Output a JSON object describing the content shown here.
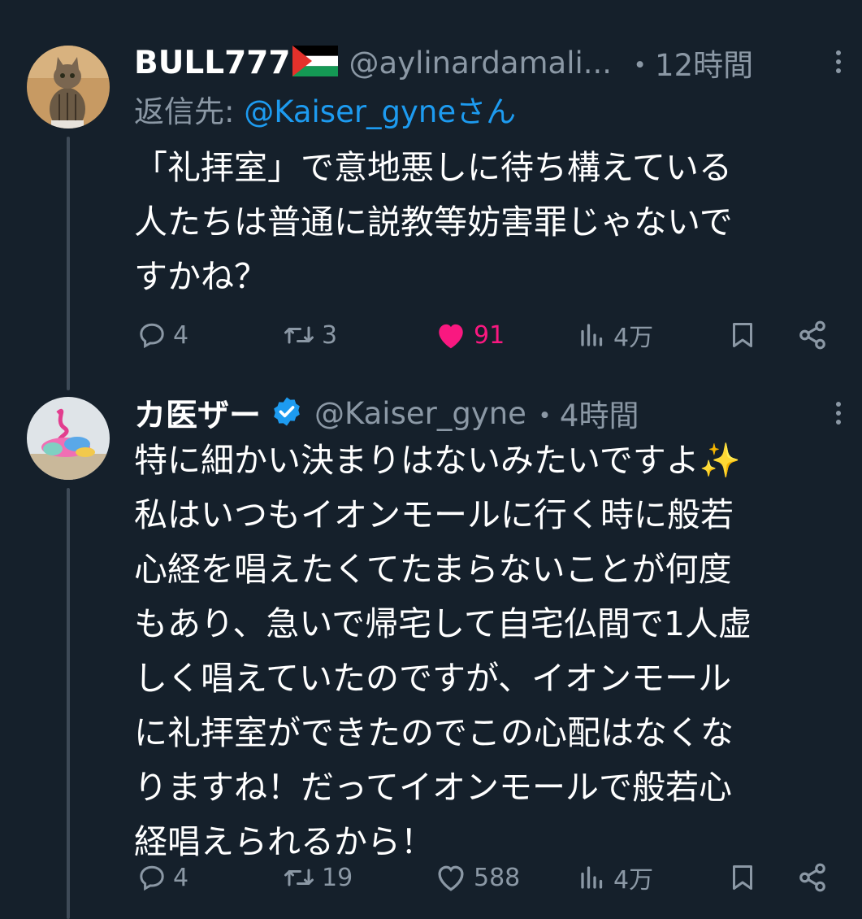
{
  "tweets": [
    {
      "display_name": "BULL777",
      "flag": "palestine-flag",
      "handle": "@aylinardamali...",
      "time": "・12時間",
      "reply_prefix": "返信先: ",
      "reply_mention": "@Kaiser_gyne",
      "reply_suffix": "さん",
      "body": [
        "「礼拝室」で意地悪しに待ち構えている",
        "人たちは普通に説教等妨害罪じゃないで",
        "すかね？"
      ],
      "actions": {
        "replies": "4",
        "retweets": "3",
        "likes": "91",
        "views": "4万",
        "liked": true
      },
      "avatar": "cat-avatar"
    },
    {
      "display_name": "カ医ザー",
      "verified": true,
      "handle": "@Kaiser_gyne",
      "time": "・4時間",
      "body": [
        "特に細かい決まりはないみたいですよ✨",
        "私はいつもイオンモールに行く時に般若",
        "心経を唱えたくてたまらないことが何度",
        "もあり、急いで帰宅して自宅仏間で1人虚",
        "しく唱えていたのですが、イオンモール",
        "に礼拝室ができたのでこの心配はなくな",
        "りますね！だってイオンモールで般若心",
        "経唱えられるから！"
      ],
      "actions": {
        "replies": "4",
        "retweets": "19",
        "likes": "588",
        "views": "4万",
        "liked": false
      },
      "avatar": "art-avatar"
    }
  ],
  "colors": {
    "background": "#15202b",
    "secondary_text": "#8b98a5",
    "link": "#1d9bf0",
    "like": "#f91880",
    "thread_line": "#3e4a57"
  }
}
